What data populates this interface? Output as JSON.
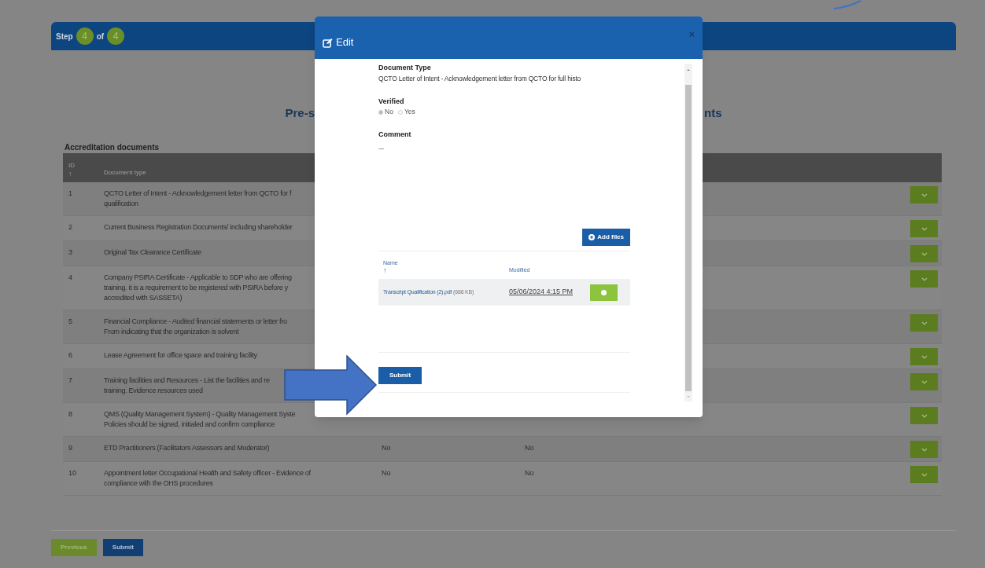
{
  "stepper": {
    "step_label": "Step",
    "current": "4",
    "of_label": "of",
    "total": "4"
  },
  "heading": {
    "left_part": "Pre-s",
    "right_part": "nts"
  },
  "section_title": "Accreditation documents",
  "table": {
    "columns": [
      {
        "label": "ID",
        "sort_arrow": "↑"
      },
      {
        "label": "Document type"
      }
    ],
    "rows": [
      {
        "id": "1",
        "document_type": [
          "QCTO Letter of Intent - Acknowledgement letter from QCTO for f",
          "qualification"
        ]
      },
      {
        "id": "2",
        "document_type": [
          "Current Business Registration Documents/ including shareholder"
        ]
      },
      {
        "id": "3",
        "document_type": [
          "Original Tax Clearance Certificate"
        ]
      },
      {
        "id": "4",
        "document_type": [
          "Company PSIRA Certificate - Applicable to SDP who are offering",
          "training. it is a requirement to be registered with PSIRA before y",
          "accredited with SASSETA)"
        ]
      },
      {
        "id": "5",
        "document_type": [
          "Financial Compliance - Audited financial statements or letter fro",
          "From indicating that the organization is solvent"
        ]
      },
      {
        "id": "6",
        "document_type": [
          "Lease Agreement for office space and training facility"
        ]
      },
      {
        "id": "7",
        "document_type": [
          "Training facilities and Resources - List the facilities and re",
          "training. Evidence resources used"
        ]
      },
      {
        "id": "8",
        "document_type": [
          "QMS (Quality Management System) - Quality Management Syste",
          "Policies should be signed, initialed and confirm compliance"
        ]
      },
      {
        "id": "9",
        "document_type": [
          "ETD Practitioners (Facilitators Assessors and Moderator)"
        ],
        "column_3": "No",
        "column_4": "No"
      },
      {
        "id": "10",
        "document_type": [
          "Appointment letter Occupational Health and Safety officer - Evidence of",
          "compliance with the OHS procedures"
        ],
        "column_3": "No",
        "column_4": "No"
      }
    ]
  },
  "footer_buttons": [
    {
      "label": "Previous",
      "kind": "secondary"
    },
    {
      "label": "Submit",
      "kind": "primary"
    }
  ],
  "modal": {
    "title": "Edit",
    "close": "×",
    "document_type_label": "Document Type",
    "document_type_value": "QCTO Letter of Intent - Acknowledgement letter from QCTO for full histo",
    "verified": {
      "label": "Verified",
      "options": [
        {
          "label": "No",
          "selected": true
        },
        {
          "label": "Yes",
          "selected": false
        }
      ]
    },
    "comment_label": "Comment",
    "add_files": "Add files",
    "files": {
      "columns": [
        {
          "label": "Name",
          "sort_arrow": "↑"
        },
        {
          "label": "Modified"
        }
      ],
      "rows": [
        {
          "name": "Transcript Qualification (2).pdf",
          "size": "(686 KB)",
          "modified": "05/06/2024 4:15 PM"
        }
      ]
    },
    "submit": "Submit"
  }
}
